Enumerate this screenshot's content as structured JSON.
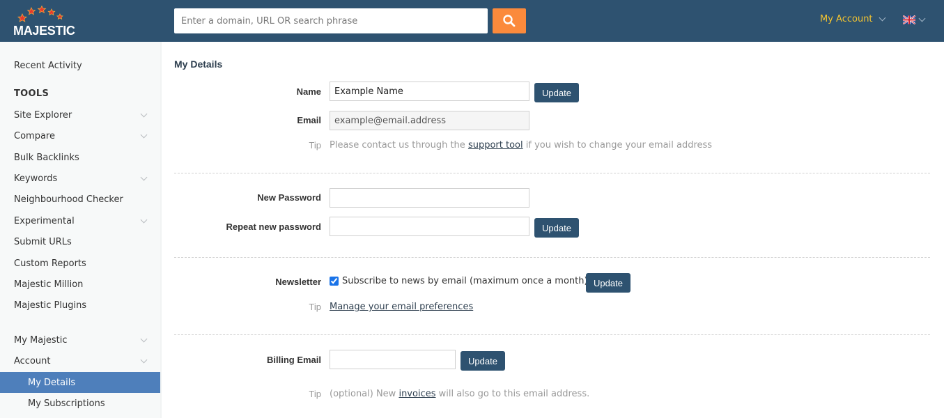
{
  "header": {
    "logo_text": "MAJESTIC",
    "search": {
      "placeholder": "Enter a domain, URL OR search phrase",
      "value": ""
    },
    "search_button_icon": "search-icon",
    "account_label": "My Account",
    "language_icon": "uk-flag-icon",
    "colors": {
      "bar": "#2e5270",
      "search_button": "#fb8a3c",
      "account_text": "#f4c430"
    }
  },
  "sidebar": {
    "recent_activity": "Recent Activity",
    "tools_heading": "TOOLS",
    "tools": [
      {
        "label": "Site Explorer",
        "expandable": true
      },
      {
        "label": "Compare",
        "expandable": true
      },
      {
        "label": "Bulk Backlinks",
        "expandable": false
      },
      {
        "label": "Keywords",
        "expandable": true
      },
      {
        "label": "Neighbourhood Checker",
        "expandable": false
      },
      {
        "label": "Experimental",
        "expandable": true
      },
      {
        "label": "Submit URLs",
        "expandable": false
      },
      {
        "label": "Custom Reports",
        "expandable": false
      },
      {
        "label": "Majestic Million",
        "expandable": false
      },
      {
        "label": "Majestic Plugins",
        "expandable": false
      }
    ],
    "sections": [
      {
        "label": "My Majestic",
        "expandable": true
      },
      {
        "label": "Account",
        "expandable": true
      }
    ],
    "account_items": [
      {
        "label": "My Details",
        "active": true
      },
      {
        "label": "My Subscriptions",
        "active": false
      }
    ],
    "active_color": "#4e7fbb"
  },
  "main": {
    "title": "My Details",
    "details": {
      "name_label": "Name",
      "name_value": "Example Name",
      "email_label": "Email",
      "email_value": "example@email.address",
      "update_label": "Update",
      "tip_label": "Tip",
      "tip_before": "Please contact us through the ",
      "tip_link": "support tool",
      "tip_after": " if you wish to change your email address"
    },
    "password": {
      "new_label": "New Password",
      "new_value": "",
      "repeat_label": "Repeat new password",
      "repeat_value": "",
      "update_label": "Update"
    },
    "newsletter": {
      "label": "Newsletter",
      "checkbox_label": "Subscribe to news by email (maximum once a month)",
      "checked": true,
      "update_label": "Update",
      "tip_label": "Tip",
      "tip_link": "Manage your email preferences"
    },
    "billing": {
      "label": "Billing Email",
      "value": "",
      "update_label": "Update",
      "tip_label": "Tip",
      "tip_before": "(optional) New ",
      "tip_link": "invoices",
      "tip_after": " will also go to this email address."
    }
  }
}
